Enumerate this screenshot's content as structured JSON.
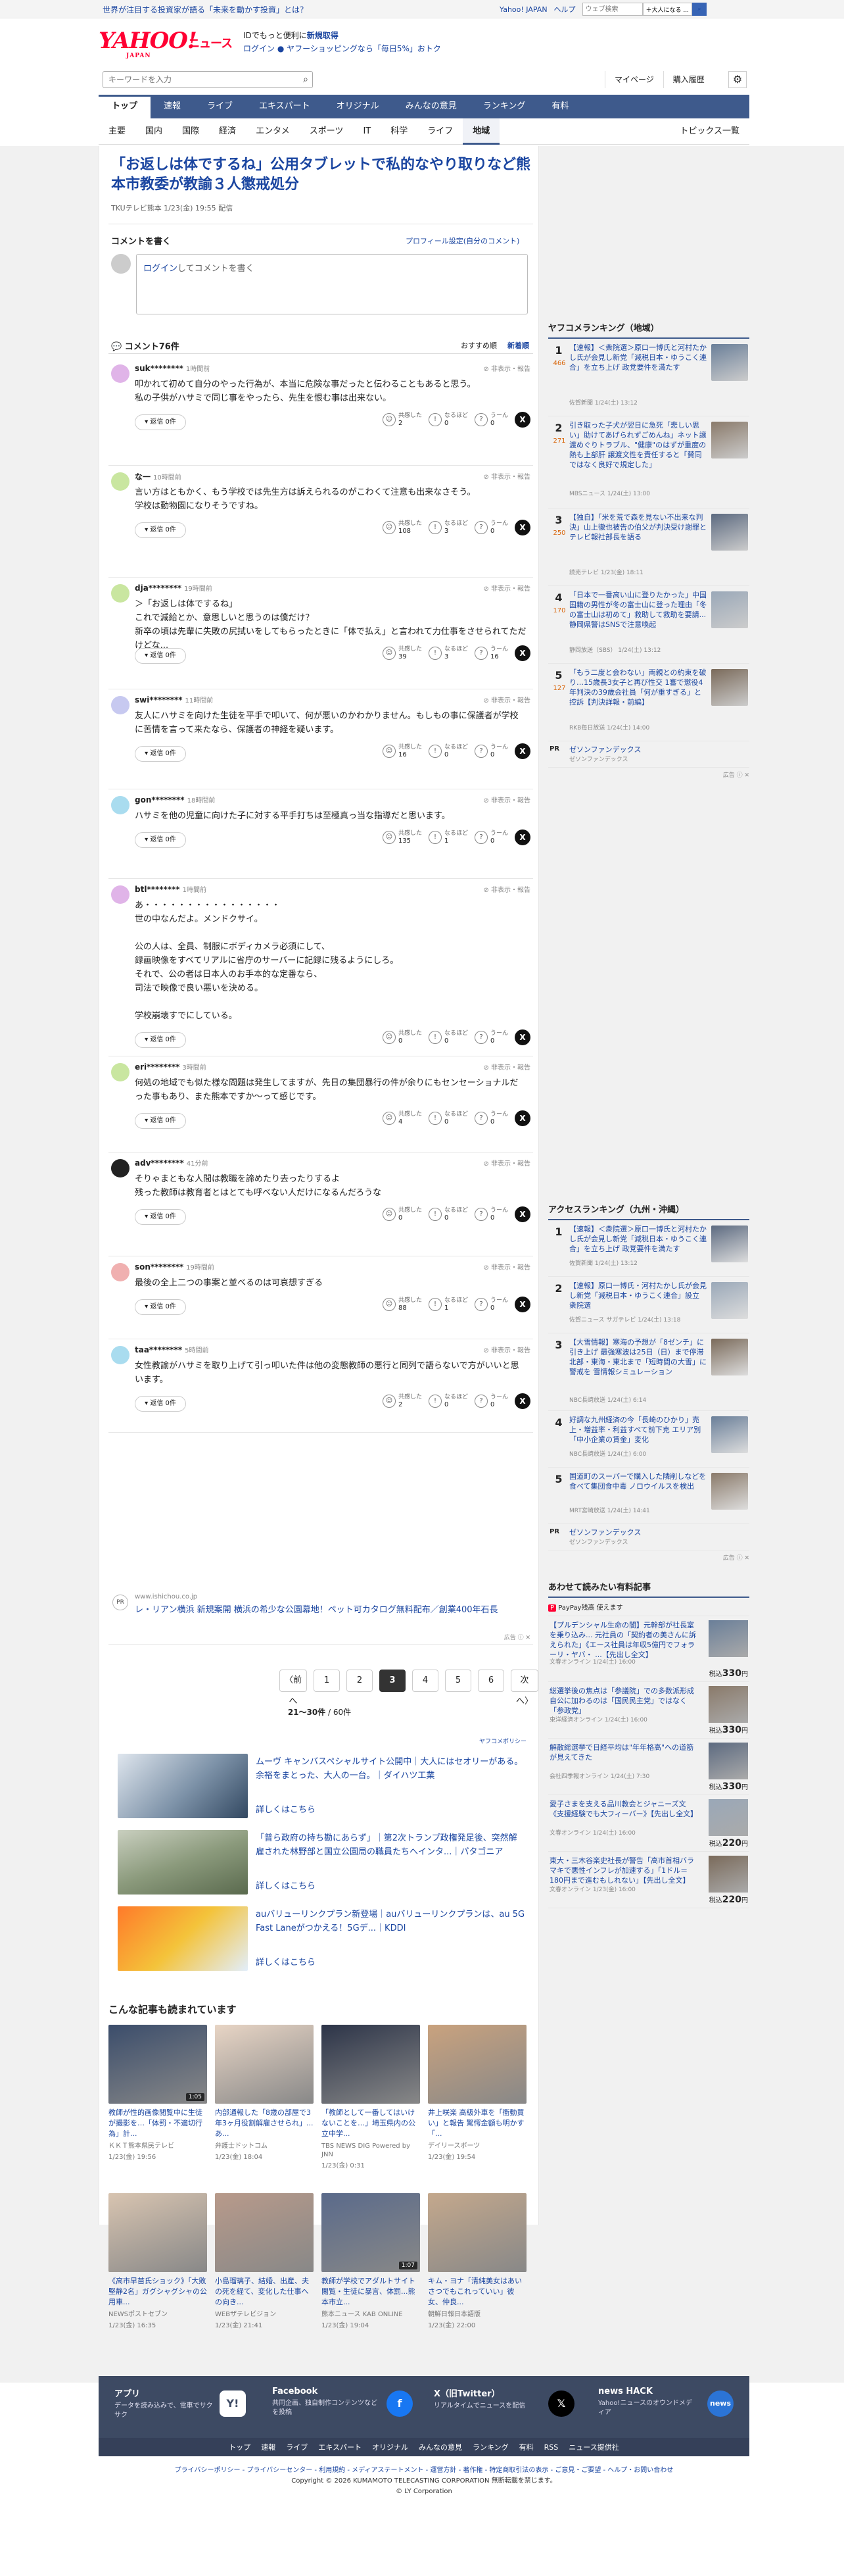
{
  "topbar": {
    "promo": "世界が注目する投資家が語る「未来を動かす投資」とは？",
    "links": [
      "Yahoo! JAPAN",
      "ヘルプ"
    ],
    "search_placeholder": "ウェブ検索",
    "search_button": "＋大人になる ..."
  },
  "header": {
    "logo": "YAHOO!",
    "logo_japan": "JAPAN",
    "logo_news": "ニュース",
    "promo_line1_a": "IDでもっと便利に",
    "promo_line1_b": "新規取得",
    "promo_line2": "ログイン ● ヤフーショッピングなら「毎日5%」おトク"
  },
  "searchbar": {
    "placeholder": "キーワードを入力",
    "links": [
      "マイページ",
      "購入履歴"
    ]
  },
  "nav1": [
    "トップ",
    "速報",
    "ライブ",
    "エキスパート",
    "オリジナル",
    "みんなの意見",
    "ランキング",
    "有料"
  ],
  "nav2": [
    "主要",
    "国内",
    "国際",
    "経済",
    "エンタメ",
    "スポーツ",
    "IT",
    "科学",
    "ライフ",
    "地域"
  ],
  "nav2_topics": "トピックス一覧",
  "article": {
    "title": "「お返しは体でするね」公用タブレットで私的なやり取りなど熊本市教委が教諭３人懲戒処分",
    "meta": "TKUテレビ熊本  1/23(金) 19:55 配信"
  },
  "comment_form": {
    "heading": "コメントを書く",
    "profile_link": "プロフィール設定(自分のコメント)",
    "login": "ログイン",
    "placeholder_suffix": "してコメントを書く"
  },
  "comments_header": {
    "title": "コメント76件",
    "sort_recommended": "おすすめ順",
    "sort_new": "新着順"
  },
  "reaction_labels": {
    "agree": "共感した",
    "naruhodo": "なるほど",
    "hmm": "うーん",
    "reply": "返信 0件",
    "report": "非表示・報告"
  },
  "comments": [
    {
      "user": "suk********",
      "time": "1時間前",
      "text": "叩かれて初めて自分のやった行為が、本当に危険な事だったと伝わることもあると思う。\n私の子供がハサミで同じ事をやったら、先生を恨む事は出来ない。",
      "agree": "2",
      "naruhodo": "0",
      "hmm": "0"
    },
    {
      "user": "な一",
      "time": "10時間前",
      "text": "言い方はともかく、もう学校では先生方は訴えられるのがこわくて注意も出来なさそう。\n学校は動物園になりそうですね。",
      "agree": "108",
      "naruhodo": "3",
      "hmm": "0"
    },
    {
      "user": "dja********",
      "time": "19時間前",
      "text": "＞「お返しは体でするね」\nこれで減給とか、意思しいと思うのは僕だけ？\n新卒の頃は先輩に失敗の尻拭いをしてもらったときに「体で払え」と言われて力仕事をさせられてただけどな...",
      "agree": "39",
      "naruhodo": "3",
      "hmm": "16"
    },
    {
      "user": "swi********",
      "time": "11時間前",
      "text": "友人にハサミを向けた生徒を平手で叩いて、何が悪いのかわかりません。もしもの事に保護者が学校に苦情を言って来たなら、保護者の神経を疑います。",
      "agree": "16",
      "naruhodo": "0",
      "hmm": "0"
    },
    {
      "user": "gon********",
      "time": "18時間前",
      "text": "ハサミを他の児童に向けた子に対する平手打ちは至極真っ当な指導だと思います。",
      "agree": "135",
      "naruhodo": "1",
      "hmm": "0"
    },
    {
      "user": "btl********",
      "time": "1時間前",
      "text": "あ・・・・・・・・・・・・・・・・\n世の中なんだよ。メンドクサイ。\n\n公の人は、全員、制服にボディカメラ必須にして、\n録画映像をすべてリアルに省庁のサーバーに記録に残るようにしろ。\nそれで、公の者は日本人のお手本的な定番なら、\n司法で映像で良い悪いを決める。\n\n学校崩壊すでにしている。",
      "agree": "0",
      "naruhodo": "0",
      "hmm": "0"
    },
    {
      "user": "eri********",
      "time": "3時間前",
      "text": "何処の地域でも似た様な問題は発生してますが、先日の集団暴行の件が余りにもセンセーショナルだった事もあり、また熊本ですか〜って感じです。",
      "agree": "4",
      "naruhodo": "0",
      "hmm": "0"
    },
    {
      "user": "adv********",
      "time": "41分前",
      "text": "そりゃまともな人間は教職を諦めたり去ったりするよ\n残った教師は教育者とはとても呼べない人だけになるんだろうな",
      "agree": "0",
      "naruhodo": "0",
      "hmm": "0"
    },
    {
      "user": "son********",
      "time": "19時間前",
      "text": "最後の全上二つの事案と並べるのは可哀想すぎる",
      "agree": "88",
      "naruhodo": "1",
      "hmm": "0"
    },
    {
      "user": "taa********",
      "time": "5時間前",
      "text": "女性教諭がハサミを取り上げて引っ叩いた件は他の変態教師の悪行と同列で語らないで方がいいと思います。",
      "agree": "2",
      "naruhodo": "0",
      "hmm": "0"
    }
  ],
  "ad": {
    "badge": "PR",
    "domain": "www.ishichou.co.jp",
    "title": "レ・リアン横浜 新規案開 横浜の希少な公園幕地！ペット可カタログ無料配布／創業400年石長",
    "mark": "広告 ⓘ ✕"
  },
  "pager": {
    "prev": "〈前へ",
    "pages": [
      "1",
      "2",
      "3",
      "4",
      "5",
      "6"
    ],
    "current": "3",
    "next": "次へ〉",
    "range": "21〜30件",
    "total": "/ 60件"
  },
  "yahoo_ad_label": "ヤフコメポリシー",
  "promos": [
    {
      "text": "ムーヴ キャンバスペシャルサイト公開中｜大人にはセオリーがある。余裕をまとった、大人の一台。｜ダイハツ工業",
      "more": "詳しくはこちら"
    },
    {
      "text": "「普ら政府の持ち勘にあらず」｜第2次トランプ政権発足後、突然解雇された林野部と国立公園局の職員たちへインタ...｜パタゴニア",
      "more": "詳しくはこちら"
    },
    {
      "text": "auバリューリンクプラン新登場｜auバリューリンクプランは、au 5G Fast Laneがつかえる！5Gデ...｜KDDI",
      "more": "詳しくはこちら"
    }
  ],
  "related_heading": "こんな記事も読まれています",
  "related": [
    {
      "title": "教師が性的画像閲覧中に生徒が撮影を…「体罰・不適切行為」計...",
      "source": "ＫＫＴ熊本県民テレビ",
      "date": "1/23(金) 19:56",
      "video": "1:05"
    },
    {
      "title": "内部通報した「8歳の部屋で3年3ヶ月役割解雇させられ」...あ...",
      "source": "弁護士ドットコム",
      "date": "1/23(金) 18:04",
      "video": ""
    },
    {
      "title": "「教師として一番してはいけないことを…」埼玉県内の公立中学...",
      "source": "TBS NEWS DIG Powered by JNN",
      "date": "1/23(金) 0:31",
      "video": ""
    },
    {
      "title": "井上咲楽 高級外車を「衝動買い」と報告 驚愕金額も明かす「...",
      "source": "デイリースポーツ",
      "date": "1/23(金) 19:54",
      "video": ""
    },
    {
      "title": "《高市早苗氏ショック》「大敗堅静2名」ガグシャグシャの公用車...",
      "source": "NEWSポストセブン",
      "date": "1/23(金) 16:35",
      "video": ""
    },
    {
      "title": "小島瑠璃子、結婚、出産、夫の死を経て、変化した仕事への向き...",
      "source": "WEBザテレビジョン",
      "date": "1/23(金) 21:41",
      "video": ""
    },
    {
      "title": "教師が学校でアダルトサイト閲覧・生徒に暴言、体罰...熊本市立...",
      "source": "熊本ニュース KAB ONLINE",
      "date": "1/23(金) 19:04",
      "video": "1:07"
    },
    {
      "title": "キム・ヨナ「清純美女はあいさつでもこれっていい」彼女、仲良...",
      "source": "朝鮮日報日本語版",
      "date": "1/23(金) 22:00",
      "video": ""
    }
  ],
  "sidebar": {
    "ranking_title": "ヤフコメランキング（地域）",
    "ranking": [
      {
        "num": "1",
        "count": "466",
        "title": "【速報】＜衆院選＞原口一博氏と河村たかし氏が会見し新党「減税日本・ゆうこく連合」を立ち上げ 政党要件を満たす",
        "source": "佐賀新聞 1/24(土) 13:12"
      },
      {
        "num": "2",
        "count": "271",
        "title": "引き取った子犬が翌日に急死「悲しい思い」助けてあげられずごめんね」ネット譲渡めぐりトラブル、\"健康\"のはずが重度の熱も上部肝 譲渡文性を責任すると「賛同ではなく良好で規定した」",
        "source": "MBSニュース 1/24(土) 13:00"
      },
      {
        "num": "3",
        "count": "250",
        "title": "【独自】「米を荒で森を見ない不出来な判決」山上徹也被告の伯父が判決受け謝罪とテレビ報社部長を語る",
        "source": "読売テレビ 1/23(金) 18:11"
      },
      {
        "num": "4",
        "count": "170",
        "title": "「日本で一番高い山に登りたかった」中国国籍の男性が冬の富士山に登った理由「冬の富士山は初めて」救助して救助を要請...静岡県警はSNSで注意喚起",
        "source": "静岡放送（SBS） 1/24(土) 13:12"
      },
      {
        "num": "5",
        "count": "127",
        "title": "「もう二度と会わない」両親との約束を破り…15歳長3女子と再び性交 1審で懲役4年判決の39歳会社員「何が重すぎる」と控訴【判決詳報・前編】",
        "source": "RKB毎日放送 1/24(土) 14:00"
      }
    ],
    "pr": {
      "badge": "PR",
      "title": "ゼソンファンデックス",
      "sub": "ゼソンファンデックス"
    },
    "admark": "広告 ⓘ ✕",
    "access_title": "アクセスランキング（九州・沖縄）",
    "access": [
      {
        "num": "1",
        "title": "【速報】＜衆院選＞原口一博氏と河村たかし氏が会見し新党「減税日本・ゆうこく連合」を立ち上げ 政党要件を満たす",
        "source": "佐賀新聞 1/24(土) 13:12"
      },
      {
        "num": "2",
        "title": "【速報】原口一博氏・河村たかし氏が会見し新党「減税日本・ゆうこく連合」設立 衆院選",
        "source": "佐賀ニュース サガテレビ 1/24(土) 13:18"
      },
      {
        "num": "3",
        "title": "【大雪情報】寒海の予想が「8ゼンチ」に引き上げ 最強寒波は25日（日）まで停滞 北部・東海・東北まで「短時間の大雪」に警戒を 雪情報シミュレーション",
        "source": "NBC長崎放送 1/24(土) 6:14"
      },
      {
        "num": "4",
        "title": "好調な九州経済の今「長崎のひかり」売上・増益率・利益すべて前下克 エリア別「中小企業の賃金」変化",
        "source": "NBC長崎放送 1/24(土) 6:00"
      },
      {
        "num": "5",
        "title": "国道町のスーパーで購入した隣削しなどを食べて集団食中毒 ノロウイルスを検出",
        "source": "MRT宮崎放送 1/24(土) 14:41"
      }
    ],
    "pr2": {
      "badge": "PR",
      "title": "ゼソンファンデックス",
      "sub": "ゼソンファンデックス"
    },
    "admark2": "広告 ⓘ ✕",
    "paid_title": "あわせて読みたい有料記事",
    "paypay": "PayPay残高 使えます",
    "paid": [
      {
        "title": "【プルデンシャル生命の闇】元幹部が社長室を乗り込み... 元社員の「契約者の美さんに訴えられた」《エース社員は年収5億円でフォラーリ・ヤバ・ ...【先出し全文】",
        "source": "文春オンライン 1/24(土) 16:00",
        "price": "330"
      },
      {
        "title": "総選挙後の焦点は「参議院」での多数派形成 自公に加わるのは「国民民主党」ではなく「参政党」",
        "source": "東洋経済オンライン 1/24(土) 16:00",
        "price": "330"
      },
      {
        "title": "解散総選挙で日経平均は\"年年格高\"への道筋が見えてきた",
        "source": "会社四季報オンライン 1/24(土) 7:30",
        "price": "330"
      },
      {
        "title": "愛子さまを支える品川教会とジャニーズ文《支援経験でも大フィーバー》【先出し全文】",
        "source": "文春オンライン 1/24(土) 16:00",
        "price": "220"
      },
      {
        "title": "東大・三木谷楽史社長が警告「高市首相バラマキで悪性インフレが加速する」「1ドル＝180円まで進むもしれない」【先出し全文】",
        "source": "文春オンライン 1/23(金) 16:00",
        "price": "220"
      }
    ],
    "price_prefix": "税込",
    "price_suffix": "円"
  },
  "footer": {
    "items": [
      {
        "title": "アプリ",
        "desc": "データを読み込みで、電車でサクサク"
      },
      {
        "title": "Facebook",
        "desc": "共同企画、独自制作コンテンツなどを投稿"
      },
      {
        "title": "X（旧Twitter）",
        "desc": "リアルタイムでニュースを配信"
      },
      {
        "title": "news HACK",
        "desc": "Yahoo!ニュースのオウンドメディア"
      }
    ],
    "nav": [
      "トップ",
      "速報",
      "ライブ",
      "エキスパート",
      "オリジナル",
      "みんなの意見",
      "ランキング",
      "有料",
      "RSS",
      "ニュース提供社"
    ],
    "links": "プライバシーポリシー - プライバシーセンター - 利用規約 - メディアステートメント - 運営方針 - 著作権 - 特定商取引法の表示 - ご意見・ご要望 - ヘルプ・お問い合わせ",
    "copyright": "Copyright © 2026 KUMAMOTO TELECASTING CORPORATION 無断転載を禁じます。",
    "ly": "© LY Corporation"
  }
}
